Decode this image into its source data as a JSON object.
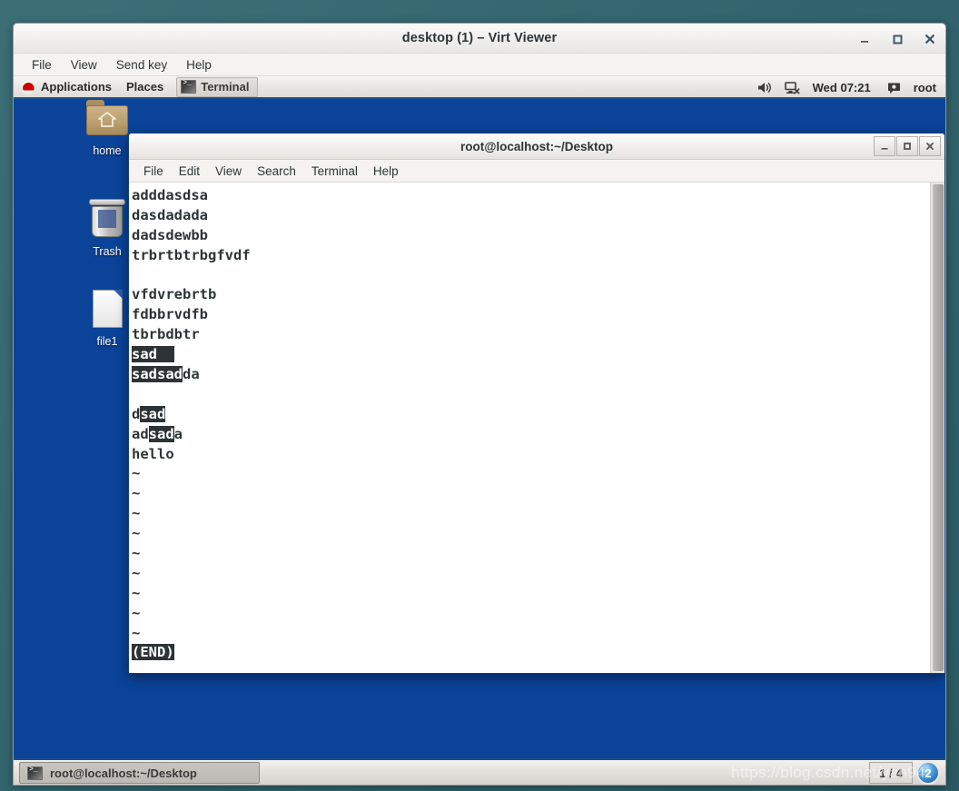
{
  "viewer": {
    "title": "desktop (1) – Virt Viewer",
    "menu": [
      "File",
      "View",
      "Send key",
      "Help"
    ],
    "window_buttons": [
      {
        "name": "minimize",
        "glyph": "_"
      },
      {
        "name": "maximize",
        "glyph": "□"
      },
      {
        "name": "close",
        "glyph": "✕"
      }
    ]
  },
  "guest": {
    "top_panel": {
      "applications_label": "Applications",
      "places_label": "Places",
      "window_task_label": "Terminal",
      "clock": "Wed 07:21",
      "user": "root",
      "tray_icons": [
        "volume-icon",
        "network-disconnected-icon",
        "message-icon"
      ]
    },
    "desktop_icons": [
      {
        "name": "home",
        "label": "home",
        "icon": "home-folder-icon"
      },
      {
        "name": "trash",
        "label": "Trash",
        "icon": "trash-icon"
      },
      {
        "name": "file1",
        "label": "file1",
        "icon": "document-icon"
      }
    ],
    "terminal": {
      "title": "root@localhost:~/Desktop",
      "menu": [
        "File",
        "Edit",
        "View",
        "Search",
        "Terminal",
        "Help"
      ],
      "window_buttons": [
        {
          "name": "minimize",
          "glyph": "_"
        },
        {
          "name": "maximize",
          "glyph": "□"
        },
        {
          "name": "close",
          "glyph": "✕"
        }
      ],
      "lines": [
        [
          {
            "t": "adddasdsa",
            "h": false
          }
        ],
        [
          {
            "t": "dasdadada",
            "h": false
          }
        ],
        [
          {
            "t": "dadsdewbb",
            "h": false
          }
        ],
        [
          {
            "t": "trbrtbtrbgfvdf",
            "h": false
          }
        ],
        [],
        [
          {
            "t": "vfdvrebrtb",
            "h": false
          }
        ],
        [
          {
            "t": "fdbbrvdfb",
            "h": false
          }
        ],
        [
          {
            "t": "tbrbdbtr",
            "h": false
          }
        ],
        [
          {
            "t": "sad",
            "h": true
          },
          {
            "t": "  ",
            "h": true
          }
        ],
        [
          {
            "t": "sadsad",
            "h": true
          },
          {
            "t": "da",
            "h": false
          }
        ],
        [],
        [
          {
            "t": "d",
            "h": false
          },
          {
            "t": "sad",
            "h": true
          }
        ],
        [
          {
            "t": "ad",
            "h": false
          },
          {
            "t": "sad",
            "h": true
          },
          {
            "t": "a",
            "h": false
          }
        ],
        [
          {
            "t": "hello",
            "h": false
          }
        ],
        [
          {
            "t": "~",
            "h": false
          }
        ],
        [
          {
            "t": "~",
            "h": false
          }
        ],
        [
          {
            "t": "~",
            "h": false
          }
        ],
        [
          {
            "t": "~",
            "h": false
          }
        ],
        [
          {
            "t": "~",
            "h": false
          }
        ],
        [
          {
            "t": "~",
            "h": false
          }
        ],
        [
          {
            "t": "~",
            "h": false
          }
        ],
        [
          {
            "t": "~",
            "h": false
          }
        ],
        [
          {
            "t": "~",
            "h": false
          }
        ],
        [
          {
            "t": "(END)",
            "h": true
          }
        ]
      ]
    },
    "bottom_panel": {
      "task_label": "root@localhost:~/Desktop",
      "workspace_label": "1 / 4",
      "show_desktop_label": "2"
    }
  },
  "watermark": "https://blog.csdn.net/yan94",
  "colors": {
    "desktop_blue": "#0b4399",
    "panel_accent": "#1c4f8c",
    "terminal_fg": "#2e3436",
    "terminal_bg": "#ffffff"
  }
}
